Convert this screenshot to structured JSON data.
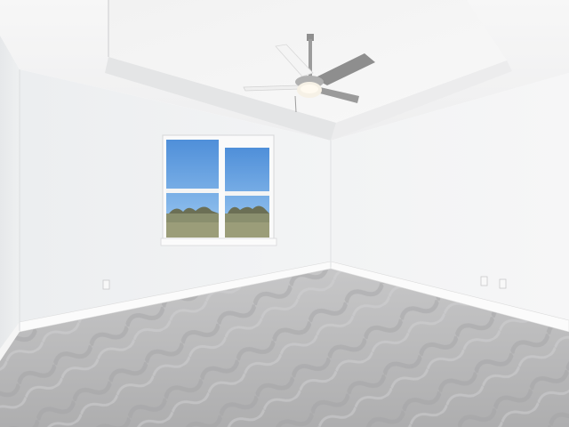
{
  "scene": {
    "subject": "empty-room",
    "colors": {
      "wall_left": "#eef0f1",
      "wall_back": "#f1f2f3",
      "wall_right": "#f3f4f5",
      "ceiling": "#f6f6f6",
      "carpet": "#b9b9ba",
      "sky": "#5a9be0",
      "fan_metal": "#9a9a9a"
    },
    "icons": [
      "ceiling-fan-icon",
      "light-bulb-icon",
      "electrical-outlet-icon",
      "window-icon"
    ]
  }
}
